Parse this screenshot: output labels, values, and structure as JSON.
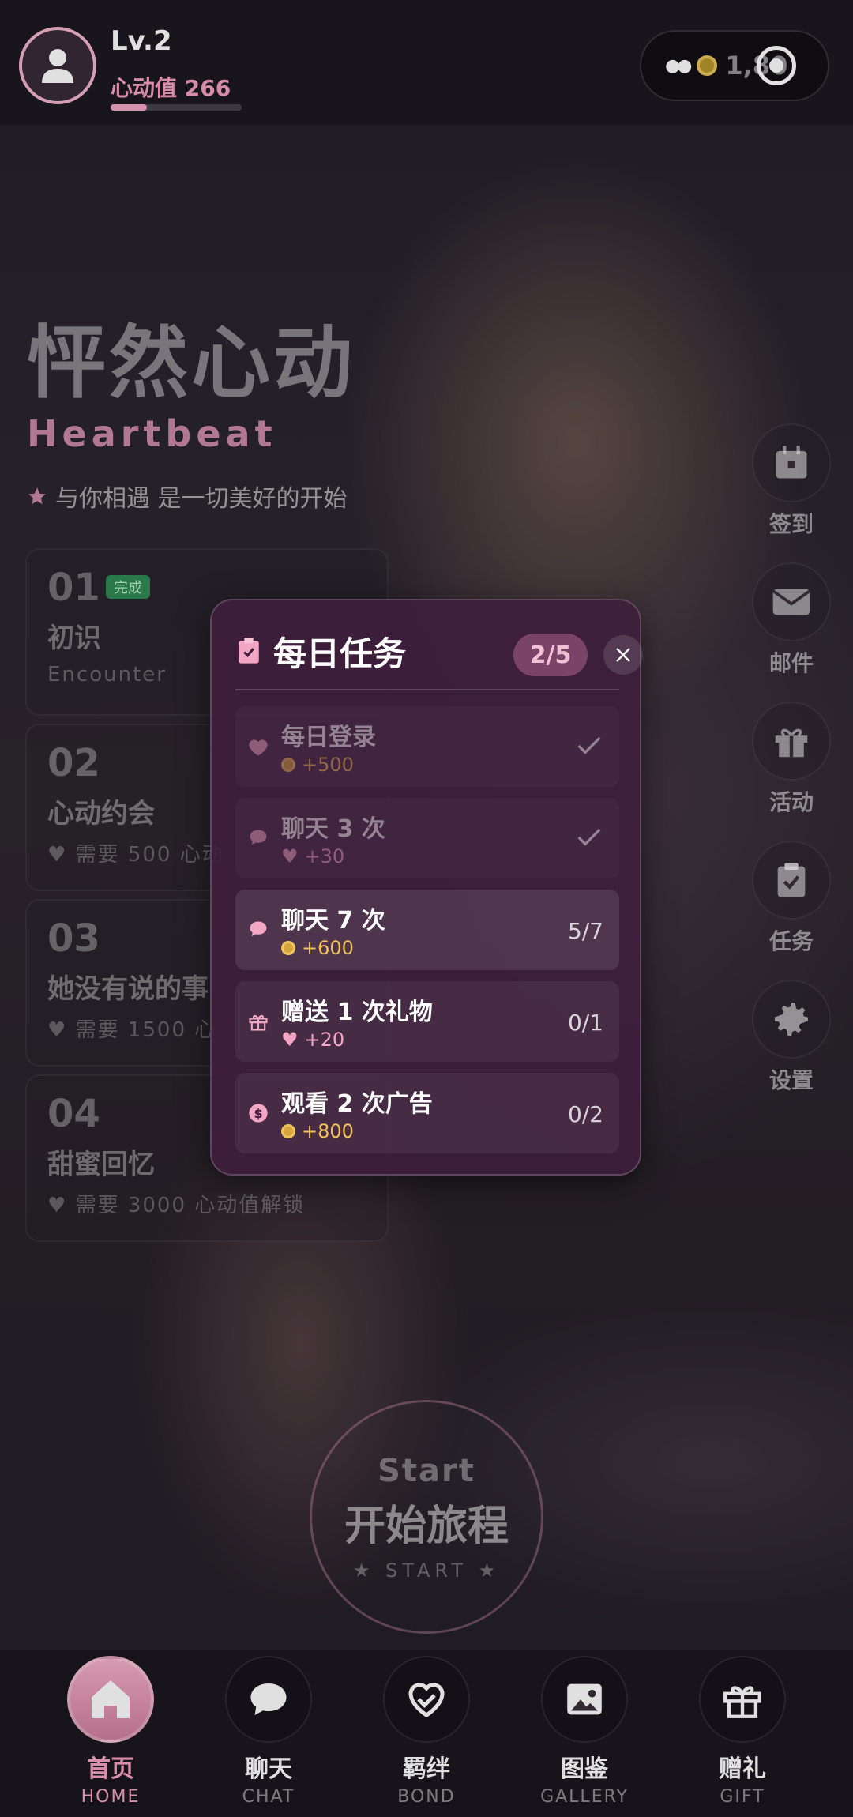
{
  "header": {
    "level": "Lv.2",
    "heart_value_label": "心动值 266",
    "heart_progress": 0.28,
    "coins": "1,80"
  },
  "hero": {
    "title_cn": "怦然心动",
    "title_en": "Heartbeat",
    "tagline": "与你相遇 是一切美好的开始"
  },
  "chapters": [
    {
      "num": "01",
      "badge": "完成",
      "title": "初识",
      "subtitle": "Encounter"
    },
    {
      "num": "02",
      "title": "心动约会",
      "requirement": "需要 500 心动"
    },
    {
      "num": "03",
      "title": "她没有说的事",
      "requirement": "需要 1500 心"
    },
    {
      "num": "04",
      "title": "甜蜜回忆",
      "requirement": "需要 3000 心动值解锁"
    }
  ],
  "side_menu": [
    {
      "label": "签到",
      "icon": "calendar-icon"
    },
    {
      "label": "邮件",
      "icon": "mail-icon"
    },
    {
      "label": "活动",
      "icon": "gift-icon"
    },
    {
      "label": "任务",
      "icon": "clipboard-icon"
    },
    {
      "label": "设置",
      "icon": "gear-icon"
    }
  ],
  "start": {
    "en": "Start",
    "cn": "开始旅程",
    "sub": "START"
  },
  "modal": {
    "title": "每日任务",
    "count": "2/5",
    "tasks": [
      {
        "name": "每日登录",
        "reward": "+500",
        "reward_type": "coin",
        "status": "done"
      },
      {
        "name": "聊天 3 次",
        "reward": "+30",
        "reward_type": "heart",
        "status": "done"
      },
      {
        "name": "聊天 7 次",
        "reward": "+600",
        "reward_type": "coin",
        "progress": "5/7",
        "status": "active"
      },
      {
        "name": "赠送 1 次礼物",
        "reward": "+20",
        "reward_type": "heart",
        "progress": "0/1",
        "status": "pending"
      },
      {
        "name": "观看 2 次广告",
        "reward": "+800",
        "reward_type": "coin",
        "progress": "0/2",
        "status": "pending"
      }
    ]
  },
  "nav": [
    {
      "label": "首页",
      "sub": "HOME",
      "icon": "home-icon",
      "active": true
    },
    {
      "label": "聊天",
      "sub": "CHAT",
      "icon": "chat-icon"
    },
    {
      "label": "羁绊",
      "sub": "BOND",
      "icon": "heart-link-icon"
    },
    {
      "label": "图鉴",
      "sub": "GALLERY",
      "icon": "image-icon"
    },
    {
      "label": "赠礼",
      "sub": "GIFT",
      "icon": "gift-icon"
    }
  ],
  "colors": {
    "accent_pink": "#f3a6c4",
    "coin_gold": "#f2c35a",
    "modal_bg": "#3e1e3c"
  }
}
